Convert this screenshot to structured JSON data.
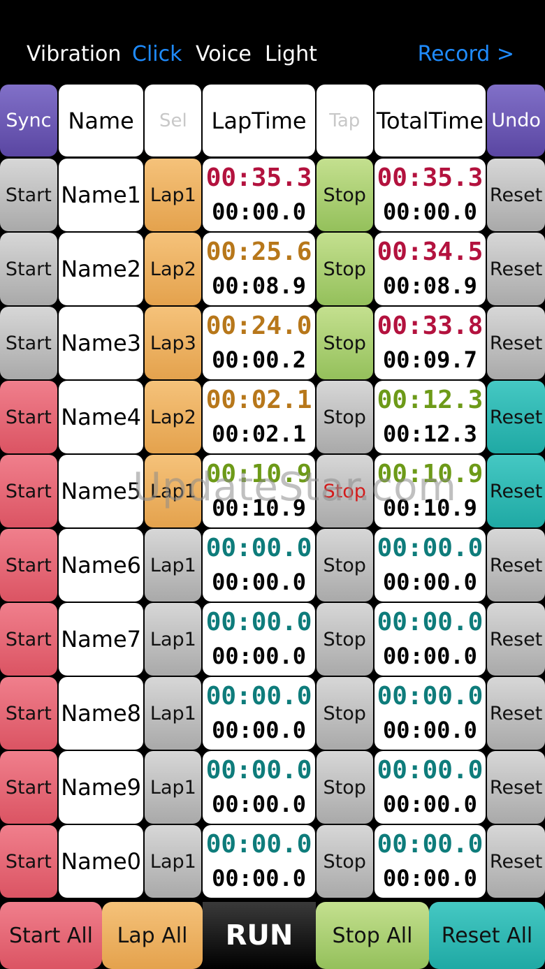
{
  "options": {
    "vibration": "Vibration",
    "click": "Click",
    "voice": "Voice",
    "light": "Light",
    "record": "Record >"
  },
  "header": {
    "sync": "Sync",
    "name": "Name",
    "sel": "Sel",
    "laptime": "LapTime",
    "tap": "Tap",
    "totaltime": "TotalTime",
    "undo": "Undo"
  },
  "rows": [
    {
      "start": "Start",
      "name": "Name1",
      "lap": "Lap1",
      "lap_top": "00:35.3",
      "lap_bot": "00:00.0",
      "stop": "Stop",
      "tot_top": "00:35.3",
      "tot_bot": "00:00.0",
      "reset": "Reset"
    },
    {
      "start": "Start",
      "name": "Name2",
      "lap": "Lap2",
      "lap_top": "00:25.6",
      "lap_bot": "00:08.9",
      "stop": "Stop",
      "tot_top": "00:34.5",
      "tot_bot": "00:08.9",
      "reset": "Reset"
    },
    {
      "start": "Start",
      "name": "Name3",
      "lap": "Lap3",
      "lap_top": "00:24.0",
      "lap_bot": "00:00.2",
      "stop": "Stop",
      "tot_top": "00:33.8",
      "tot_bot": "00:09.7",
      "reset": "Reset"
    },
    {
      "start": "Start",
      "name": "Name4",
      "lap": "Lap2",
      "lap_top": "00:02.1",
      "lap_bot": "00:02.1",
      "stop": "Stop",
      "tot_top": "00:12.3",
      "tot_bot": "00:12.3",
      "reset": "Reset"
    },
    {
      "start": "Start",
      "name": "Name5",
      "lap": "Lap1",
      "lap_top": "00:10.9",
      "lap_bot": "00:10.9",
      "stop": "Stop",
      "tot_top": "00:10.9",
      "tot_bot": "00:10.9",
      "reset": "Reset"
    },
    {
      "start": "Start",
      "name": "Name6",
      "lap": "Lap1",
      "lap_top": "00:00.0",
      "lap_bot": "00:00.0",
      "stop": "Stop",
      "tot_top": "00:00.0",
      "tot_bot": "00:00.0",
      "reset": "Reset"
    },
    {
      "start": "Start",
      "name": "Name7",
      "lap": "Lap1",
      "lap_top": "00:00.0",
      "lap_bot": "00:00.0",
      "stop": "Stop",
      "tot_top": "00:00.0",
      "tot_bot": "00:00.0",
      "reset": "Reset"
    },
    {
      "start": "Start",
      "name": "Name8",
      "lap": "Lap1",
      "lap_top": "00:00.0",
      "lap_bot": "00:00.0",
      "stop": "Stop",
      "tot_top": "00:00.0",
      "tot_bot": "00:00.0",
      "reset": "Reset"
    },
    {
      "start": "Start",
      "name": "Name9",
      "lap": "Lap1",
      "lap_top": "00:00.0",
      "lap_bot": "00:00.0",
      "stop": "Stop",
      "tot_top": "00:00.0",
      "tot_bot": "00:00.0",
      "reset": "Reset"
    },
    {
      "start": "Start",
      "name": "Name0",
      "lap": "Lap1",
      "lap_top": "00:00.0",
      "lap_bot": "00:00.0",
      "stop": "Stop",
      "tot_top": "00:00.0",
      "tot_bot": "00:00.0",
      "reset": "Reset"
    }
  ],
  "bottom": {
    "start_all": "Start All",
    "lap_all": "Lap All",
    "run": "RUN",
    "stop_all": "Stop All",
    "reset_all": "Reset All"
  },
  "watermark": "UpdateStar.com",
  "colors": {
    "accent_blue": "#1f8cff",
    "crimson": "#b3123e",
    "brown": "#b7771a",
    "olive": "#6d9a18",
    "teal_text": "#0e7c7b"
  }
}
